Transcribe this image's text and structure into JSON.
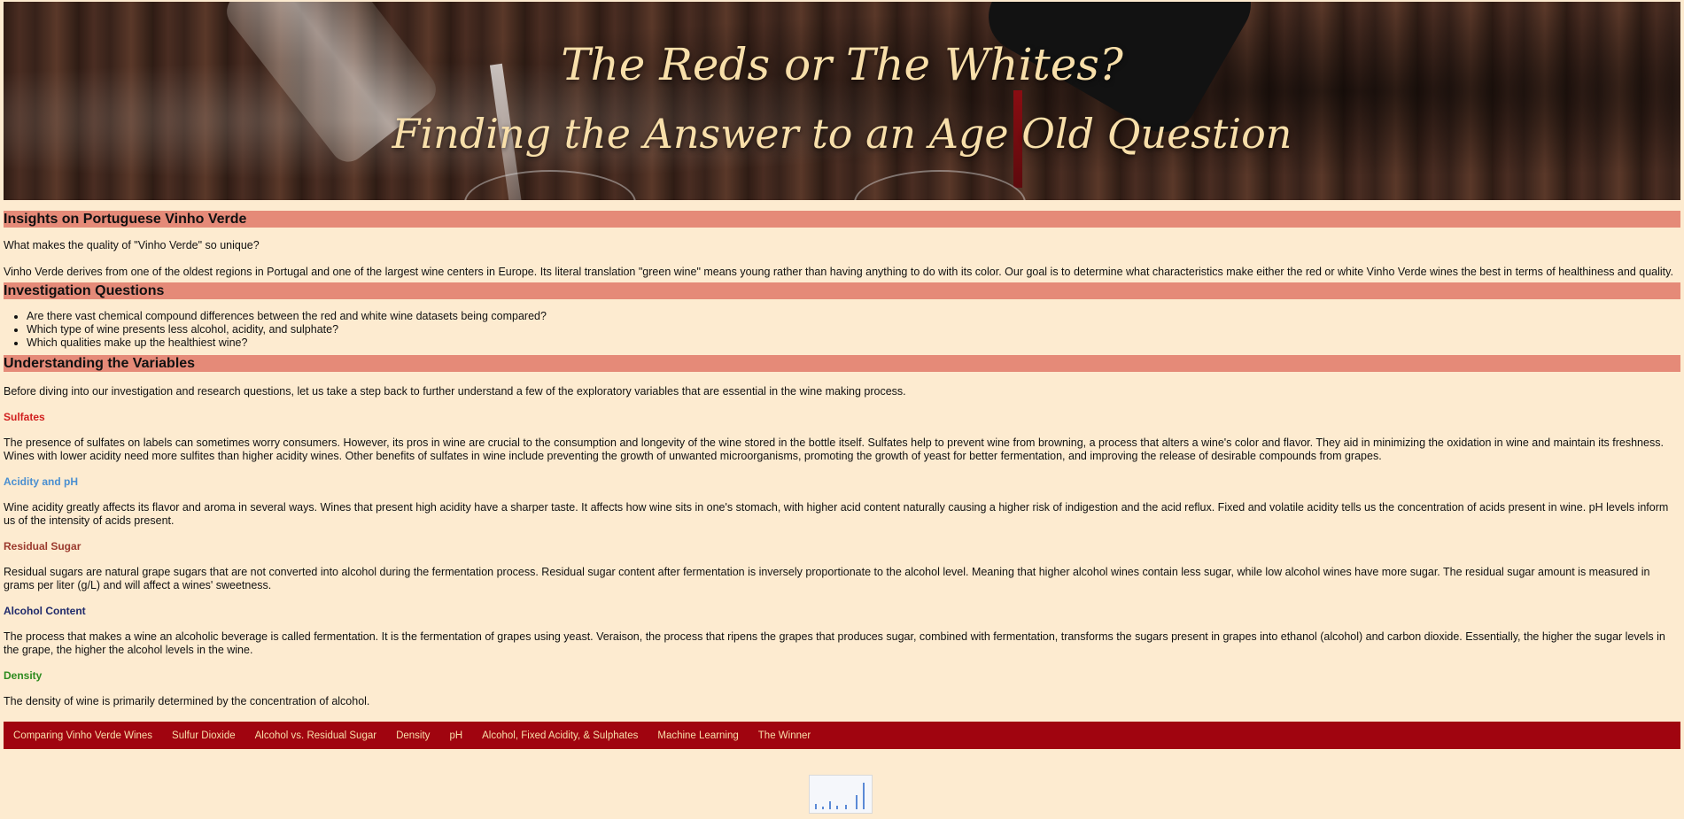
{
  "header": {
    "title": "The Reds or The Whites?",
    "subtitle": "Finding the Answer to an Age Old Question"
  },
  "insights": {
    "heading": "Insights on Portuguese Vinho Verde",
    "question": "What makes the quality of \"Vinho Verde\" so unique?",
    "paragraph": "Vinho Verde derives from one of the oldest regions in Portugal and one of the largest wine centers in Europe. Its literal translation \"green wine\" means young rather than having anything to do with its color. Our goal is to determine what characteristics make either the red or white Vinho Verde wines the best in terms of healthiness and quality."
  },
  "investigation": {
    "heading": "Investigation Questions",
    "items": [
      "Are there vast chemical compound differences between the red and white wine datasets being compared?",
      "Which type of wine presents less alcohol, acidity, and sulphate?",
      "Which qualities make up the healthiest wine?"
    ]
  },
  "variables": {
    "heading": "Understanding the Variables",
    "intro": "Before diving into our investigation and research questions, let us take a step back to further understand a few of the exploratory variables that are essential in the wine making process.",
    "items": [
      {
        "title": "Sulfates",
        "color": "#d11f1f",
        "text": "The presence of sulfates on labels can sometimes worry consumers. However, its pros in wine are crucial to the consumption and longevity of the wine stored in the bottle itself. Sulfates help to prevent wine from browning, a process that alters a wine's color and flavor. They aid in minimizing the oxidation in wine and maintain its freshness. Wines with lower acidity need more sulfites than higher acidity wines. Other benefits of sulfates in wine include preventing the growth of unwanted microorganisms, promoting the growth of yeast for better fermentation, and improving the release of desirable compounds from grapes."
      },
      {
        "title": "Acidity and pH",
        "color": "#4a8fd1",
        "text": "Wine acidity greatly affects its flavor and aroma in several ways. Wines that present high acidity have a sharper taste. It affects how wine sits in one's stomach, with higher acid content naturally causing a higher risk of indigestion and the acid reflux. Fixed and volatile acidity tells us the concentration of acids present in wine. pH levels inform us of the intensity of acids present."
      },
      {
        "title": "Residual Sugar",
        "color": "#9b3a2e",
        "text": "Residual sugars are natural grape sugars that are not converted into alcohol during the fermentation process. Residual sugar content after fermentation is inversely proportionate to the alcohol level. Meaning that higher alcohol wines contain less sugar, while low alcohol wines have more sugar. The residual sugar amount is measured in grams per liter (g/L) and will affect a wines' sweetness."
      },
      {
        "title": "Alcohol Content",
        "color": "#1f2a6b",
        "text": "The process that makes a wine an alcoholic beverage is called fermentation. It is the fermentation of grapes using yeast. Veraison, the process that ripens the grapes that produces sugar, combined with fermentation, transforms the sugars present in grapes into ethanol (alcohol) and carbon dioxide. Essentially, the higher the sugar levels in the grape, the higher the alcohol levels in the wine."
      },
      {
        "title": "Density",
        "color": "#2e8b1f",
        "text": "The density of wine is primarily determined by the concentration of alcohol."
      }
    ]
  },
  "nav": {
    "links": [
      "Comparing Vinho Verde Wines",
      "Sulfur Dioxide",
      "Alcohol vs. Residual Sugar",
      "Density",
      "pH",
      "Alcohol, Fixed Acidity, & Sulphates",
      "Machine Learning",
      "The Winner"
    ]
  },
  "colors": {
    "page_background": "#fdebd0",
    "section_bar": "#e58a78",
    "nav_background": "#a0040f",
    "nav_text": "#f8dfaa",
    "hero_text": "#f8dfaa"
  }
}
